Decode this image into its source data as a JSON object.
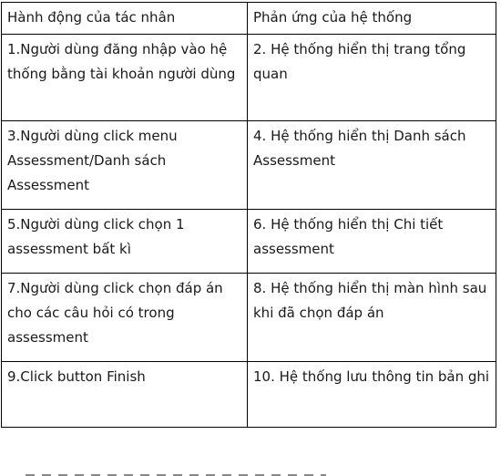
{
  "table": {
    "header": {
      "actor": "Hành động của tác nhân",
      "system": "Phản ứng của hệ thống"
    },
    "rows": [
      {
        "actor": "1.Người dùng đăng nhập vào hệ thống bằng tài khoản người dùng",
        "system": "2. Hệ thống hiển thị trang tổng quan"
      },
      {
        "actor": "3.Người dùng click menu Assessment/Danh sách Assessment",
        "system": "4. Hệ thống hiển thị Danh sách Assessment"
      },
      {
        "actor": "5.Người dùng click chọn 1 assessment bất kì",
        "system": "6. Hệ thống hiển thị Chi tiết assessment"
      },
      {
        "actor": "7.Người dùng click chọn đáp án cho các câu hỏi có trong assessment",
        "system": "8. Hệ thống hiển thị màn hình sau khi đã chọn đáp án"
      },
      {
        "actor": "9.Click button Finish",
        "system": "10. Hệ thống lưu thông tin bản ghi"
      }
    ]
  }
}
